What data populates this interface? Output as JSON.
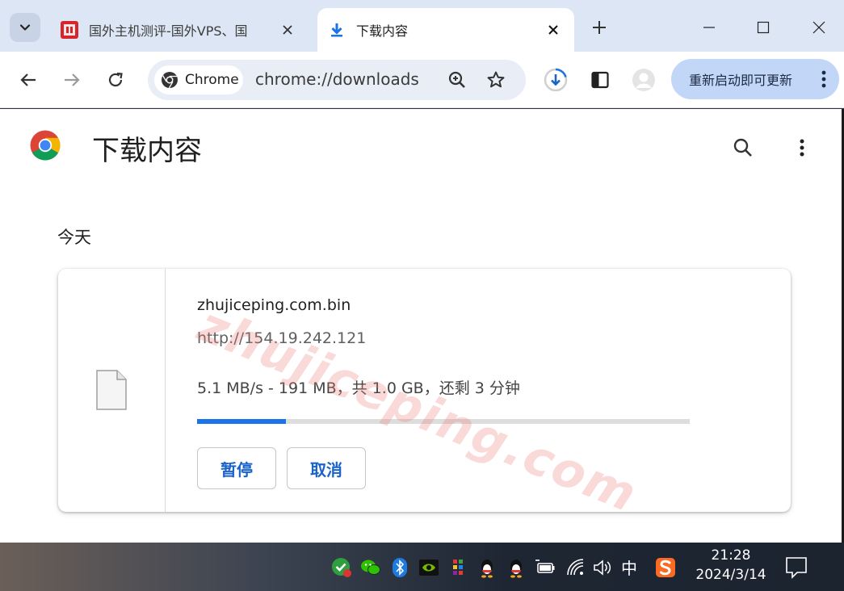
{
  "tabs": [
    {
      "title": "国外主机测评-国外VPS、国",
      "active": false
    },
    {
      "title": "下载内容",
      "active": true
    }
  ],
  "address_bar": {
    "chip_label": "Chrome",
    "url": "chrome://downloads"
  },
  "update_button": {
    "label": "重新启动即可更新"
  },
  "page": {
    "title": "下载内容",
    "date_header": "今天",
    "watermark": "zhujiceping.com"
  },
  "download": {
    "file_name": "zhujiceping.com.bin",
    "url": "http://154.19.242.121",
    "status": "5.1 MB/s - 191 MB，共 1.0 GB，还剩 3 分钟",
    "progress_fraction": 0.18,
    "pause_label": "暂停",
    "cancel_label": "取消"
  },
  "taskbar": {
    "ime": "中",
    "time": "21:28",
    "date": "2024/3/14"
  },
  "colors": {
    "accent": "#1a73e8",
    "tabstrip": "#dde6f4",
    "update_chip": "#c2d7f7"
  }
}
